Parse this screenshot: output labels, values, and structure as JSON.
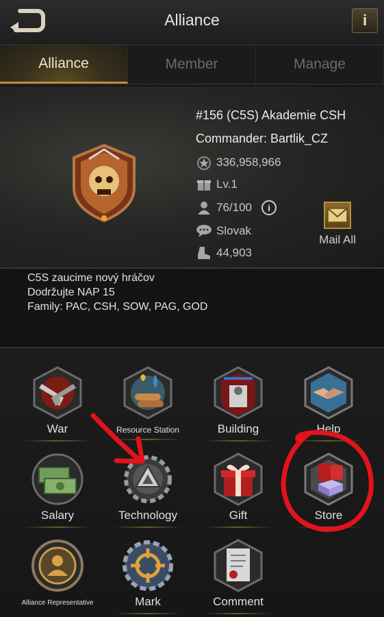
{
  "header": {
    "title": "Alliance"
  },
  "tabs": [
    {
      "label": "Alliance",
      "active": true
    },
    {
      "label": "Member",
      "active": false
    },
    {
      "label": "Manage",
      "active": false
    }
  ],
  "alliance": {
    "name": "#156 (C5S) Akademie CSH",
    "commander": "Commander: Bartlik_CZ",
    "power": "336,958,966",
    "level": "Lv.1",
    "members": "76/100",
    "language": "Slovak",
    "kills": "44,903"
  },
  "mail_all_label": "Mail All",
  "description": [
    "C5S zaucime nový hráčov",
    "Dodržujte NAP 15",
    "Family: PAC, CSH, SOW, PAG, GOD"
  ],
  "menu": {
    "war": "War",
    "resource_station": "Resource Station",
    "building": "Building",
    "help": "Help",
    "salary": "Salary",
    "technology": "Technology",
    "gift": "Gift",
    "store": "Store",
    "alliance_representative": "Alliance Representative",
    "mark": "Mark",
    "comment": "Comment"
  },
  "icons": {
    "back": "back-arrow-icon",
    "info": "info-icon",
    "power": "power-star-icon",
    "level": "gift-box-icon",
    "members": "person-icon",
    "language": "speech-bubble-icon",
    "kills": "boot-icon",
    "mail": "envelope-icon"
  },
  "colors": {
    "accent_gold": "#b98f3d",
    "annotation_red": "#e3131b"
  }
}
